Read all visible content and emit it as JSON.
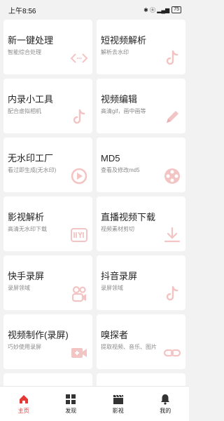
{
  "status_bar": {
    "time": "上午8:56",
    "signals": "✱ ⓝ ▂▄▆",
    "battery": "75"
  },
  "cards": [
    {
      "title": "新一键处理",
      "subtitle": "智能综合处理",
      "icon": "code-arrows-icon"
    },
    {
      "title": "短视频解析",
      "subtitle": "解析去水印",
      "icon": "tiktok-icon"
    },
    {
      "title": "内录小工具",
      "subtitle": "配合虚拟相机",
      "icon": "tiktok-icon"
    },
    {
      "title": "视频编辑",
      "subtitle": "高清gif，画中画等",
      "icon": "pencil-icon"
    },
    {
      "title": "无水印工厂",
      "subtitle": "看过即生成(无水印)",
      "icon": "play-circle-icon"
    },
    {
      "title": "MD5",
      "subtitle": "查看及修改md5",
      "icon": "film-reel-icon"
    },
    {
      "title": "影视解析",
      "subtitle": "高清无水印下载",
      "icon": "iqiyi-icon"
    },
    {
      "title": "直播视频下载",
      "subtitle": "视频素材剪切",
      "icon": "download-icon"
    },
    {
      "title": "快手录屏",
      "subtitle": "录屏领域",
      "icon": "kuaishou-icon"
    },
    {
      "title": "抖音录屏",
      "subtitle": "录屏领域",
      "icon": "tiktok-icon"
    },
    {
      "title": "视频制作(录屏)",
      "subtitle": "巧妙使用录屏",
      "icon": "video-plus-icon"
    },
    {
      "title": "嗅探者",
      "subtitle": "提取视频、音乐、图片",
      "icon": "link-icon"
    }
  ],
  "bottom_nav": [
    {
      "label": "主页",
      "icon": "home-icon",
      "active": true
    },
    {
      "label": "发现",
      "icon": "grid-icon",
      "active": false
    },
    {
      "label": "影视",
      "icon": "clapperboard-icon",
      "active": false
    },
    {
      "label": "我的",
      "icon": "bell-icon",
      "active": false
    }
  ],
  "colors": {
    "accent": "#e53935",
    "icon_tint": "#f8d7d7",
    "background": "#f2f2f2"
  }
}
